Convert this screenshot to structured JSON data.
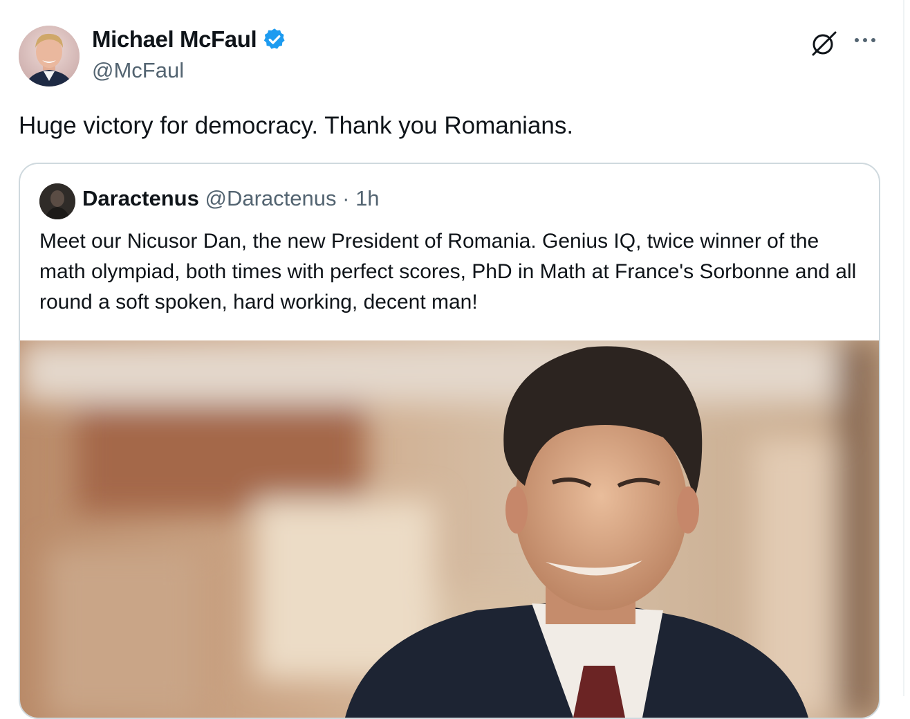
{
  "post": {
    "author": {
      "display_name": "Michael McFaul",
      "handle": "@McFaul",
      "verified": true,
      "avatar": "portrait-photo"
    },
    "text": "Huge victory for democracy. Thank you Romanians.",
    "actions": {
      "grok_icon": "grok-slash-icon",
      "more_icon": "more-dots-icon"
    }
  },
  "quote": {
    "author": {
      "display_name": "Daractenus",
      "handle": "@Daractenus",
      "separator": "·",
      "time": "1h",
      "avatar": "dark-portrait-photo"
    },
    "text": "Meet our Nicusor Dan, the new President of Romania. Genius IQ, twice winner of the math olympiad, both times with perfect scores, PhD in Math at France's Sorbonne and all round a soft spoken, hard working, decent man!",
    "media": "photo-of-smiling-man-in-suit"
  },
  "colors": {
    "verified_blue": "#1d9bf0",
    "secondary_text": "#536471",
    "border": "#cfd9de"
  }
}
